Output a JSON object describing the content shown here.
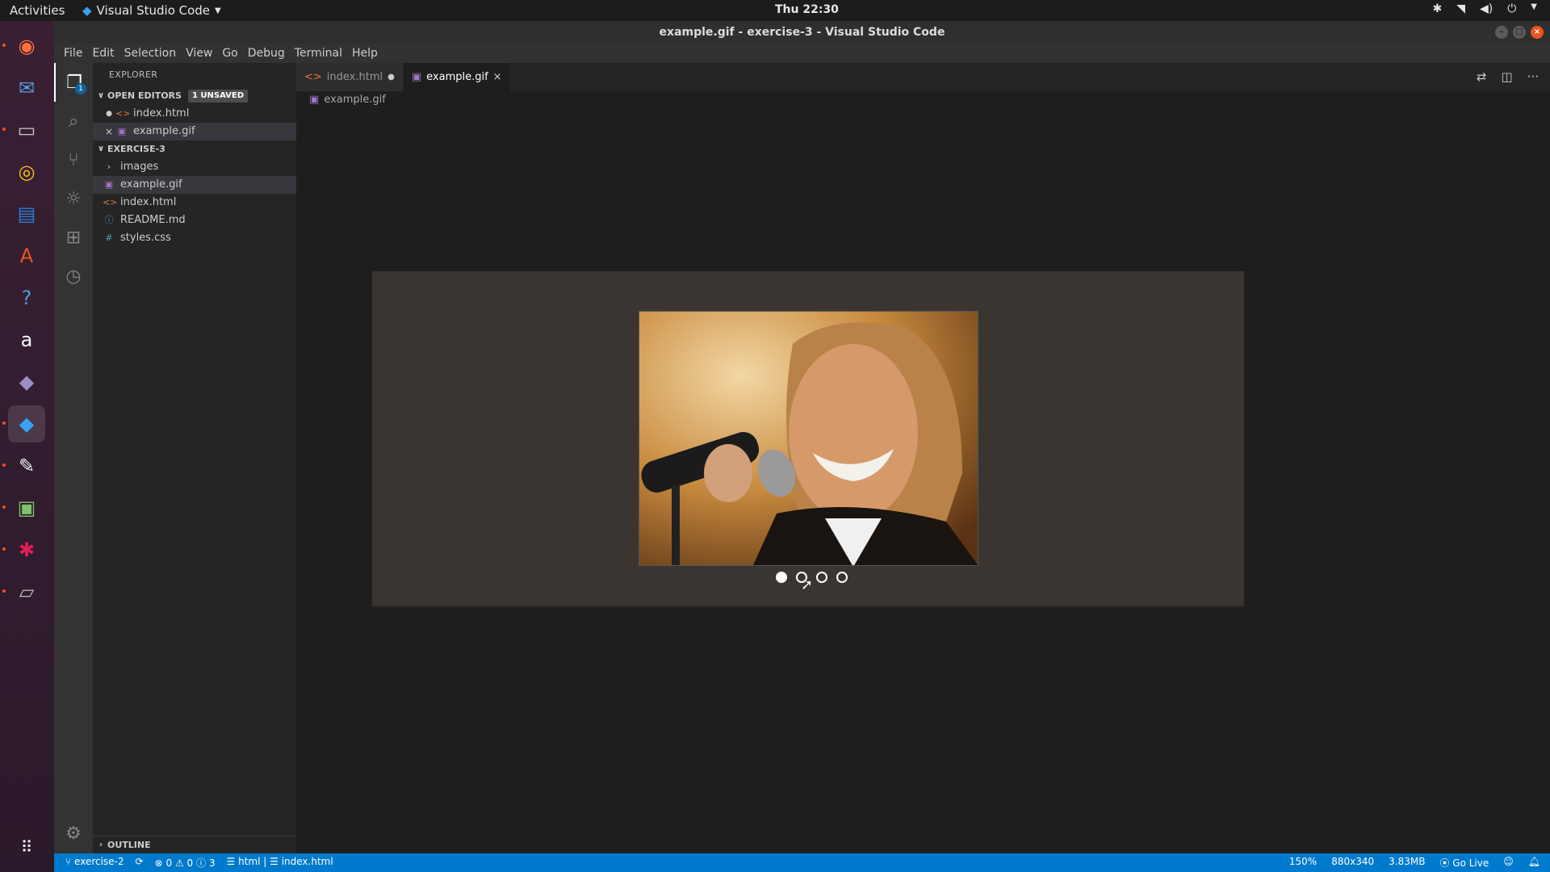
{
  "system": {
    "activities": "Activities",
    "app_name": "Visual Studio Code",
    "clock": "Thu 22:30"
  },
  "window": {
    "title": "example.gif - exercise-3 - Visual Studio Code"
  },
  "menu": [
    "File",
    "Edit",
    "Selection",
    "View",
    "Go",
    "Debug",
    "Terminal",
    "Help"
  ],
  "activity_badge": "1",
  "sidebar": {
    "title": "EXPLORER",
    "open_editors_label": "OPEN EDITORS",
    "unsaved_badge": "1 UNSAVED",
    "open_editors": [
      {
        "name": "index.html",
        "type": "html",
        "state": "unsaved"
      },
      {
        "name": "example.gif",
        "type": "gif",
        "state": "close"
      }
    ],
    "project_label": "EXERCISE-3",
    "folder": "images",
    "files": [
      {
        "name": "example.gif",
        "type": "gif",
        "selected": true
      },
      {
        "name": "index.html",
        "type": "html",
        "selected": false
      },
      {
        "name": "README.md",
        "type": "md",
        "selected": false
      },
      {
        "name": "styles.css",
        "type": "css",
        "selected": false
      }
    ],
    "outline_label": "OUTLINE"
  },
  "tabs": [
    {
      "label": "index.html",
      "type": "html",
      "active": false,
      "modified": true
    },
    {
      "label": "example.gif",
      "type": "gif",
      "active": true,
      "modified": false
    }
  ],
  "breadcrumb": "example.gif",
  "carousel": {
    "dot_count": 4,
    "active_dot": 0
  },
  "statusbar": {
    "branch": "exercise-2",
    "errors": "0",
    "warnings": "0",
    "infos": "3",
    "language": "html",
    "file": "index.html",
    "zoom": "150%",
    "dimensions": "880x340",
    "size": "3.83MB",
    "go_live": "Go Live"
  },
  "colors": {
    "statusbar": "#007acc",
    "html_icon": "#e37933",
    "gif_icon": "#a074c4",
    "accent": "#e95420"
  }
}
